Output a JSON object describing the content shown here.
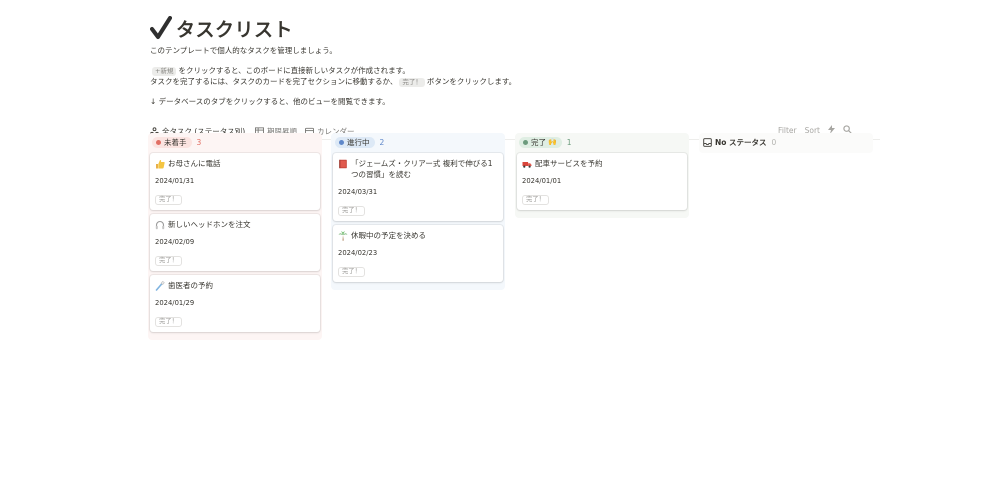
{
  "header": {
    "title": "タスクリスト",
    "desc1": "このテンプレートで個人的なタスクを管理しましょう。",
    "desc2_chip": "+新規",
    "desc2_rest": "をクリックすると、このボードに直接新しいタスクが作成されます。",
    "desc3_pre": "タスクを完了するには、タスクのカードを完了セクションに移動するか、",
    "desc3_chip": "完了！",
    "desc3_post": "ボタンをクリックします。",
    "desc4": "↓ データベースのタブをクリックすると、他のビューを閲覧できます。"
  },
  "tabs": [
    {
      "label": "全タスク (ステータス別)"
    },
    {
      "label": "期限昇順"
    },
    {
      "label": "カレンダー"
    }
  ],
  "tools": {
    "filter": "Filter",
    "sort": "Sort"
  },
  "columns": [
    {
      "name": "未着手",
      "count": "3",
      "color": "#e16f64",
      "pill_bg": "#fbe4e1",
      "cards": [
        {
          "icon": "thumbs-up-icon",
          "title": "お母さんに電話",
          "date": "2024/01/31",
          "chip": "完了！"
        },
        {
          "icon": "headphones-icon",
          "title": "新しいヘッドホンを注文",
          "date": "2024/02/09",
          "chip": "完了！"
        },
        {
          "icon": "toothbrush-icon",
          "title": "歯医者の予約",
          "date": "2024/01/29",
          "chip": "完了！"
        }
      ]
    },
    {
      "name": "進行中",
      "count": "2",
      "color": "#5e87c9",
      "pill_bg": "#dde9f6",
      "cards": [
        {
          "icon": "book-icon",
          "title": "「ジェームズ・クリアー式 複利で伸びる1つの習慣」を読む",
          "date": "2024/03/31",
          "chip": "完了！"
        },
        {
          "icon": "palm-tree-icon",
          "title": "休暇中の予定を決める",
          "date": "2024/02/23",
          "chip": "完了！"
        }
      ]
    },
    {
      "name": "完了",
      "emoji": "🙌",
      "count": "1",
      "color": "#6c9b7d",
      "pill_bg": "#dfeee3",
      "cards": [
        {
          "icon": "truck-icon",
          "title": "配車サービスを予約",
          "date": "2024/01/01",
          "chip": "完了！"
        }
      ]
    },
    {
      "name": "No ステータス",
      "count": "0",
      "color": "#787774",
      "cards": []
    }
  ]
}
